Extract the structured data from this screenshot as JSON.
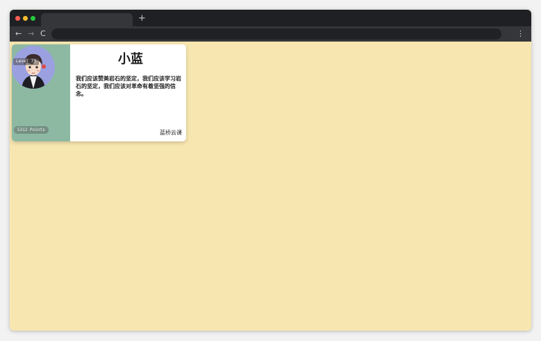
{
  "browser": {
    "new_tab_label": "+",
    "back_label": "←",
    "forward_label": "→",
    "reload_label": "C",
    "menu_label": "⋮"
  },
  "card": {
    "level": "Level 73",
    "name": "小蓝",
    "description": "我们应该赞美岩石的坚定，我们应该学习岩石的坚定，我们应该对革命有着坚强的信念。",
    "points": "5312 Points",
    "footer": "蓝桥云课"
  },
  "colors": {
    "page_background": "#f7e6b0",
    "card_side": "#8db9a3",
    "avatar_bg": "#9aa0e0"
  }
}
